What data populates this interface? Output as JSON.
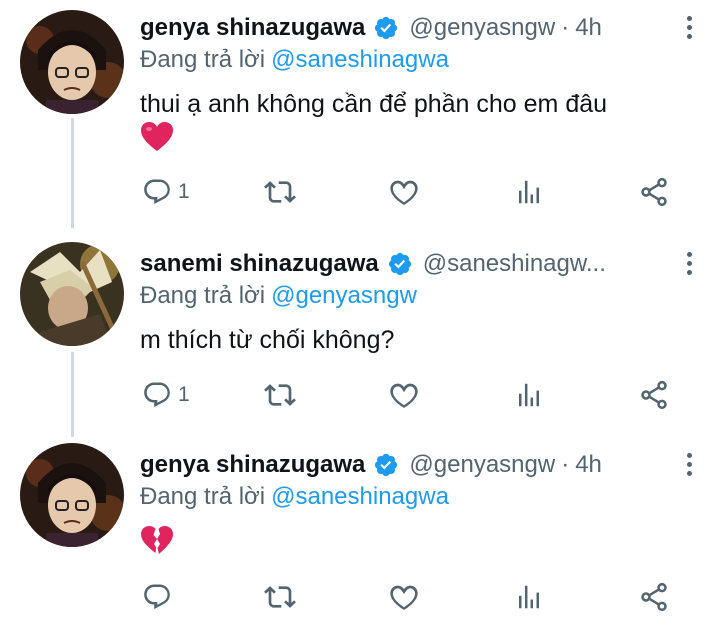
{
  "tweets": [
    {
      "name": "genya shinazugawa",
      "handle": "@genyasngw",
      "separator": "·",
      "time": "4h",
      "replying_prefix": "Đang trả lời",
      "replying_to": "@saneshinagwa",
      "text": "thui ạ anh không cần để phần cho em đâu",
      "emoji": "red-heart",
      "reply_count": "1",
      "avatar": "genya-avatar"
    },
    {
      "name": "sanemi shinazugawa",
      "handle": "@saneshinagw...",
      "separator": "",
      "time": "",
      "replying_prefix": "Đang trả lời",
      "replying_to": "@genyasngw",
      "text": "m thích từ chối không?",
      "emoji": "",
      "reply_count": "1",
      "avatar": "sanemi-avatar"
    },
    {
      "name": "genya shinazugawa",
      "handle": "@genyasngw",
      "separator": "·",
      "time": "4h",
      "replying_prefix": "Đang trả lời",
      "replying_to": "@saneshinagwa",
      "text": "",
      "emoji": "broken-heart",
      "reply_count": "",
      "avatar": "genya-avatar"
    }
  ],
  "colors": {
    "accent": "#1d9bf0",
    "secondary_text": "#536471",
    "heart": "#e0245e",
    "thread_line": "#cfd9de"
  },
  "icons": [
    "reply-icon",
    "retweet-icon",
    "like-icon",
    "stats-icon",
    "share-icon",
    "verified-badge-icon",
    "more-icon"
  ]
}
